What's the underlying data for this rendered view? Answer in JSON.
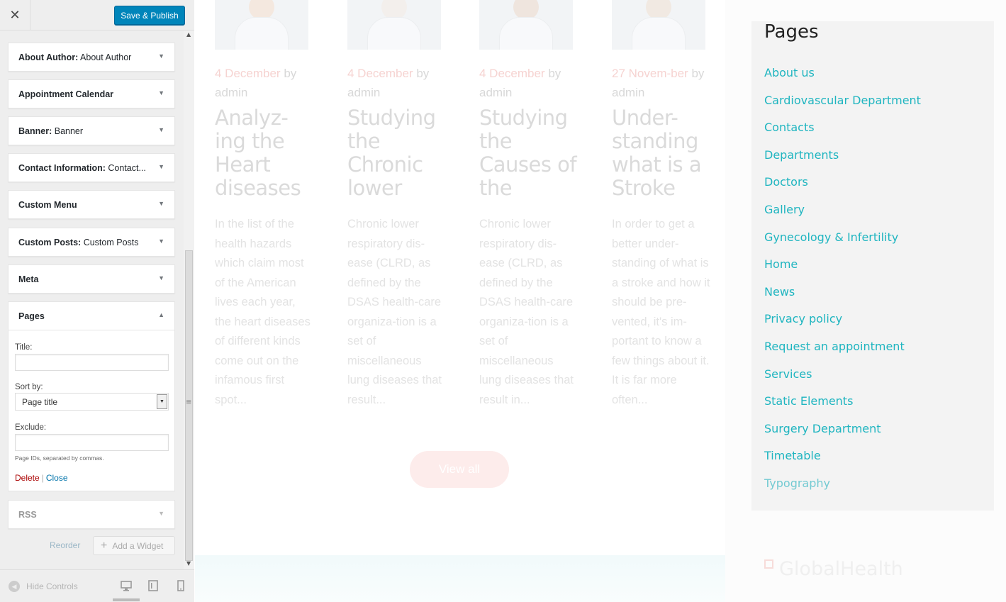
{
  "customizer": {
    "close_glyph": "✕",
    "save_label": "Save & Publish",
    "widgets": [
      {
        "name": "About Author",
        "subtitle": "About Author"
      },
      {
        "name": "Appointment Calendar",
        "subtitle": ""
      },
      {
        "name": "Banner",
        "subtitle": "Banner"
      },
      {
        "name": "Contact Information",
        "subtitle": "Contact..."
      },
      {
        "name": "Custom Menu",
        "subtitle": ""
      },
      {
        "name": "Custom Posts",
        "subtitle": "Custom Posts"
      },
      {
        "name": "Meta",
        "subtitle": ""
      }
    ],
    "pages_widget": {
      "name": "Pages",
      "title_label": "Title:",
      "title_value": "",
      "sort_label": "Sort by:",
      "sort_value": "Page title",
      "exclude_label": "Exclude:",
      "exclude_value": "",
      "exclude_hint": "Page IDs, separated by commas.",
      "delete_label": "Delete",
      "separator": "|",
      "close_label": "Close"
    },
    "rss_widget": {
      "name": "RSS"
    },
    "reorder_label": "Reorder",
    "add_widget_label": "Add a Widget",
    "hide_controls_label": "Hide Controls"
  },
  "preview": {
    "posts": [
      {
        "date": "4 December",
        "by": "by admin",
        "title": "Analyz-ing the Heart diseases",
        "excerpt": "In the list of the health hazards which claim most of the American lives each year, the heart diseases of different kinds come out on the infamous first spot..."
      },
      {
        "date": "4 December",
        "by": "by admin",
        "title": "Studying the Chronic lower",
        "excerpt": "Chronic lower respiratory dis-ease (CLRD, as defined by the DSAS health-care organiza-tion is a set of miscellaneous lung diseases that result..."
      },
      {
        "date": "4 December",
        "by": "by admin",
        "title": "Studying the Causes of the",
        "excerpt": "Chronic lower respiratory dis-ease (CLRD, as defined by the DSAS health-care organiza-tion is a set of miscellaneous lung diseases that result in..."
      },
      {
        "date": "27 Novem-ber",
        "by": "by admin",
        "title": "Under-standing what is a Stroke",
        "excerpt": "In order to get a better under-standing of what is a stroke and how it should be pre-vented, it's im-portant to know a few things about it. It is far more often..."
      }
    ],
    "view_all_label": "View all",
    "pages_widget": {
      "title": "Pages",
      "items": [
        "About us",
        "Cardiovascular Department",
        "Contacts",
        "Departments",
        "Doctors",
        "Gallery",
        "Gynecology & Infertility",
        "Home",
        "News",
        "Privacy policy",
        "Request an appointment",
        "Services",
        "Static Elements",
        "Surgery Department",
        "Timetable",
        "Typography"
      ]
    },
    "brand_name": "GlobalHealth",
    "colors": {
      "accent_teal": "#1fb5c0",
      "primary_button": "#0085ba",
      "delete_red": "#aa0000",
      "link_blue": "#0073aa"
    }
  }
}
